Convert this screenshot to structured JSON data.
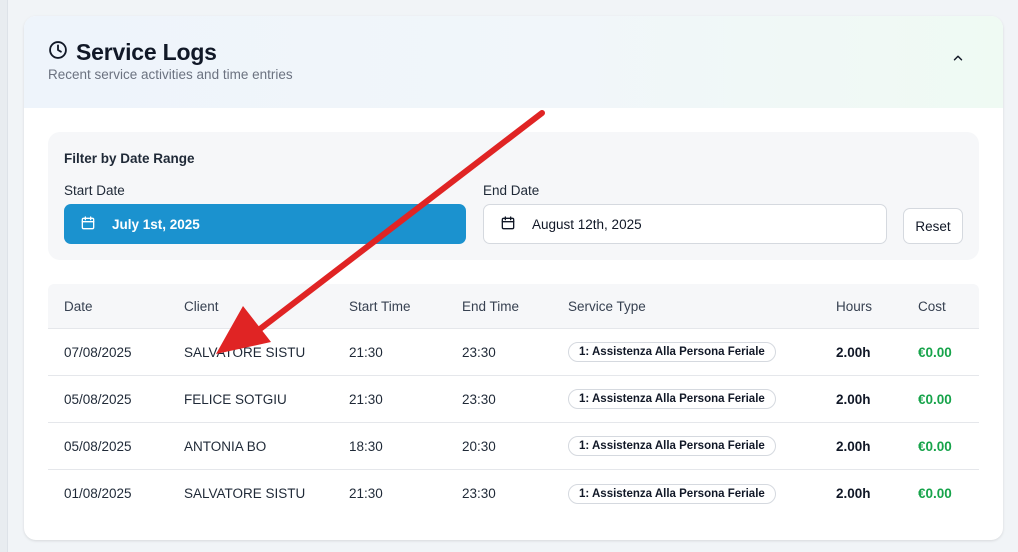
{
  "header": {
    "title": "Service Logs",
    "subtitle": "Recent service activities and time entries"
  },
  "filter": {
    "title": "Filter by Date Range",
    "start_label": "Start Date",
    "start_value": "July 1st, 2025",
    "end_label": "End Date",
    "end_value": "August 12th, 2025",
    "reset_label": "Reset"
  },
  "table": {
    "columns": [
      "Date",
      "Client",
      "Start Time",
      "End Time",
      "Service Type",
      "Hours",
      "Cost"
    ],
    "rows": [
      {
        "date": "07/08/2025",
        "client": "SALVATORE SISTU",
        "start": "21:30",
        "end": "23:30",
        "type": "1: Assistenza Alla Persona Feriale",
        "hours": "2.00h",
        "cost": "€0.00"
      },
      {
        "date": "05/08/2025",
        "client": "FELICE SOTGIU",
        "start": "21:30",
        "end": "23:30",
        "type": "1: Assistenza Alla Persona Feriale",
        "hours": "2.00h",
        "cost": "€0.00"
      },
      {
        "date": "05/08/2025",
        "client": "ANTONIA BO",
        "start": "18:30",
        "end": "20:30",
        "type": "1: Assistenza Alla Persona Feriale",
        "hours": "2.00h",
        "cost": "€0.00"
      },
      {
        "date": "01/08/2025",
        "client": "SALVATORE SISTU",
        "start": "21:30",
        "end": "23:30",
        "type": "1: Assistenza Alla Persona Feriale",
        "hours": "2.00h",
        "cost": "€0.00"
      }
    ]
  },
  "colors": {
    "accent": "#1b92cf",
    "cost_green": "#16a34a",
    "annotation_arrow": "#e02424"
  },
  "icons": {
    "title_icon": "clock-icon",
    "collapse_icon": "chevron-up-icon",
    "date_icon": "calendar-icon"
  }
}
